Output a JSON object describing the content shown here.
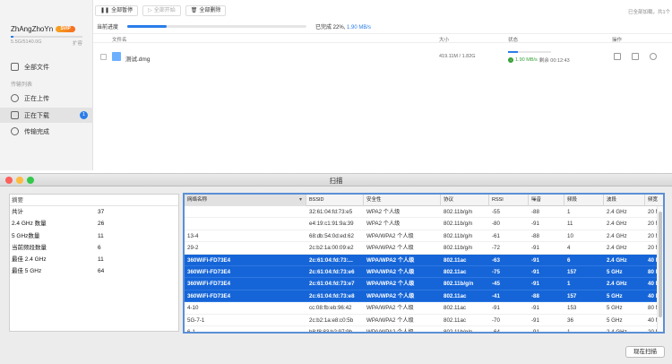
{
  "app": {
    "user": {
      "name": "ZhAngZhoYn",
      "vip": "SVIP",
      "quota": "5.5G/5140.0G",
      "expand": "扩容"
    },
    "nav": {
      "all_files": "全部文件",
      "transfer_list": "传输列表",
      "uploading": "正在上传",
      "downloading": "正在下载",
      "downloading_count": "1",
      "completed": "传输完成"
    },
    "toolbar": {
      "pause_all": "全部暂停",
      "start_all": "全部开始",
      "delete_all": "全部删除",
      "right_text": "已全部加载，共1个"
    },
    "progress": {
      "label": "当前进度",
      "percent": 22,
      "done_text": "已完成 22%,",
      "speed": "1.90 MB/s"
    },
    "list_header": {
      "name": "文件名",
      "size": "大小",
      "status": "状态",
      "actions": "操作"
    },
    "file": {
      "name": "测试.dmg",
      "size": "419.11M / 1.82G",
      "percent": 22,
      "speed": "1.90 MB/s",
      "eta": "剩余 00:12:43"
    },
    "icons": {
      "pause": "pause-icon",
      "play": "play-icon",
      "trash": "trash-icon",
      "search": "search-icon"
    }
  },
  "scan": {
    "title": "扫描",
    "summary": {
      "header": "摘要",
      "rows": [
        {
          "k": "共计",
          "v": "37"
        },
        {
          "k": "2.4 GHz 数量",
          "v": "26"
        },
        {
          "k": "5 GHz数量",
          "v": "11"
        },
        {
          "k": "当前频段数量",
          "v": "6"
        },
        {
          "k": "最佳 2.4 GHz",
          "v": "11"
        },
        {
          "k": "最佳 5 GHz",
          "v": "64"
        }
      ]
    },
    "columns": [
      "网络名称",
      "BSSID",
      "安全性",
      "协议",
      "RSSI",
      "噪音",
      "频段",
      "波段",
      "频宽"
    ],
    "rows": [
      {
        "c": [
          "",
          "32:61:04:fd:73:e5",
          "WPA2 个人级",
          "802.11b/g/n",
          "-55",
          "-88",
          "1",
          "2.4 GHz",
          "20 MH"
        ],
        "sel": false
      },
      {
        "c": [
          "",
          "e4:19:c1:91:9a:39",
          "WPA2 个人级",
          "802.11b/g/n",
          "-80",
          "-91",
          "11",
          "2.4 GHz",
          "20 MH"
        ],
        "sel": false
      },
      {
        "c": [
          "13-4",
          "68:db:54:0d:ed:62",
          "WPA/WPA2 个人级",
          "802.11b/g/n",
          "-61",
          "-88",
          "10",
          "2.4 GHz",
          "20 MH"
        ],
        "sel": false
      },
      {
        "c": [
          "29-2",
          "2c:b2:1a:00:09:e2",
          "WPA/WPA2 个人级",
          "802.11b/g/n",
          "-72",
          "-91",
          "4",
          "2.4 GHz",
          "20 MH"
        ],
        "sel": false
      },
      {
        "c": [
          "360WiFi-FD73E4",
          "2c:61:04:fd:73:...",
          "WPA/WPA2 个人级",
          "802.11ac",
          "-63",
          "-91",
          "6",
          "2.4 GHz",
          "40 MH"
        ],
        "sel": true
      },
      {
        "c": [
          "360WiFi-FD73E4",
          "2c:61:04:fd:73:e6",
          "WPA/WPA2 个人级",
          "802.11ac",
          "-75",
          "-91",
          "157",
          "5 GHz",
          "80 MH"
        ],
        "sel": true
      },
      {
        "c": [
          "360WiFi-FD73E4",
          "2c:61:04:fd:73:e7",
          "WPA/WPA2 个人级",
          "802.11b/g/n",
          "-45",
          "-91",
          "1",
          "2.4 GHz",
          "40 MH"
        ],
        "sel": true
      },
      {
        "c": [
          "360WiFi-FD73E4",
          "2c:61:04:fd:73:e8",
          "WPA/WPA2 个人级",
          "802.11ac",
          "-41",
          "-88",
          "157",
          "5 GHz",
          "40 MH"
        ],
        "sel": true
      },
      {
        "c": [
          "4-10",
          "cc:08:fb:eb:96:42",
          "WPA/WPA2 个人级",
          "802.11ac",
          "-91",
          "-91",
          "153",
          "5 GHz",
          "80 MH"
        ],
        "sel": false
      },
      {
        "c": [
          "5G-7-1",
          "2c:b2:1a:e8:c0:5b",
          "WPA/WPA2 个人级",
          "802.11ac",
          "-70",
          "-91",
          "36",
          "5 GHz",
          "40 MH"
        ],
        "sel": false
      },
      {
        "c": [
          "6-1",
          "b8:f8:83:b2:97:9b",
          "WPA/WPA2 个人级",
          "802.11b/g/n",
          "-64",
          "-91",
          "1",
          "2.4 GHz",
          "20 MH"
        ],
        "sel": false
      }
    ],
    "rescan": "现在扫描",
    "colors": {
      "selection": "#1565d8",
      "accent": "#2b7de9",
      "close": "#fc605b",
      "minimize": "#fdbc40",
      "zoom": "#34c84a"
    }
  }
}
